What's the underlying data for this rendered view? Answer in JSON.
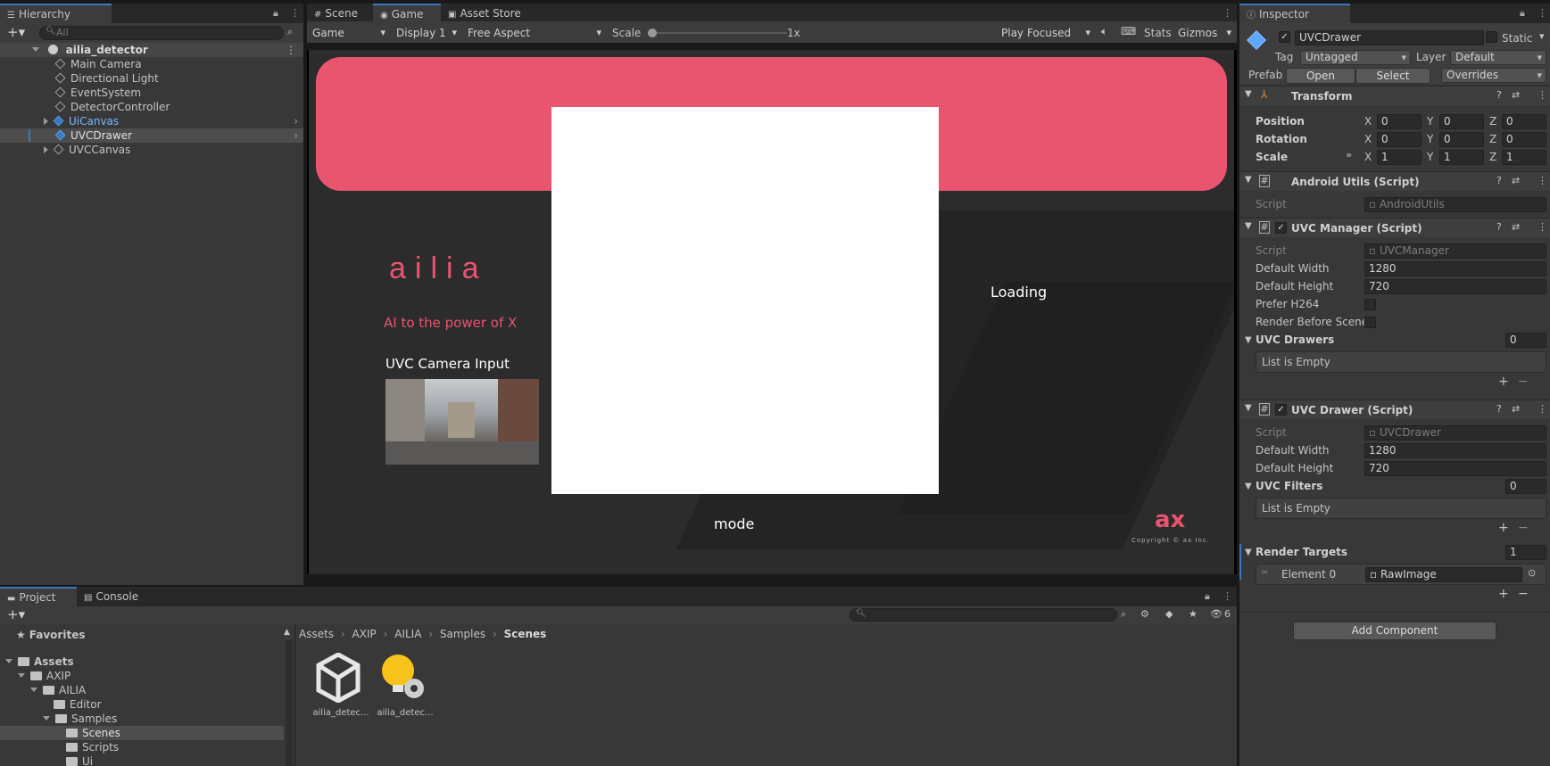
{
  "hierarchy": {
    "tab": "Hierarchy",
    "search_placeholder": "All",
    "scene": "ailia_detector",
    "items": [
      "Main Camera",
      "Directional Light",
      "EventSystem",
      "DetectorController",
      "UiCanvas",
      "UVCDrawer",
      "UVCCanvas"
    ]
  },
  "center_tabs": [
    "Scene",
    "Game",
    "Asset Store"
  ],
  "game_toolbar": {
    "mode": "Game",
    "display": "Display 1",
    "aspect": "Free Aspect",
    "scale_label": "Scale",
    "scale_value": "1x",
    "play": "Play Focused",
    "stats": "Stats",
    "gizmos": "Gizmos"
  },
  "game_view": {
    "logo": "ailia",
    "tagline": "AI to the power of X",
    "camera_label": "UVC Camera Input",
    "loading": "Loading",
    "mode": "mode",
    "ax_logo": "ax",
    "copyright": "Copyright © ax Inc.",
    "colors": {
      "banner": "#e9546e",
      "bg": "#2e2e2e",
      "accent": "#e9546e"
    }
  },
  "inspector": {
    "tab": "Inspector",
    "object_name": "UVCDrawer",
    "static_label": "Static",
    "tag_label": "Tag",
    "tag_value": "Untagged",
    "layer_label": "Layer",
    "layer_value": "Default",
    "prefab_label": "Prefab",
    "open": "Open",
    "select": "Select",
    "overrides": "Overrides",
    "transform": {
      "title": "Transform",
      "rows": [
        {
          "label": "Position",
          "x": "0",
          "y": "0",
          "z": "0"
        },
        {
          "label": "Rotation",
          "x": "0",
          "y": "0",
          "z": "0"
        },
        {
          "label": "Scale",
          "x": "1",
          "y": "1",
          "z": "1"
        }
      ],
      "axes": [
        "X",
        "Y",
        "Z"
      ]
    },
    "android_utils": {
      "title": "Android Utils (Script)",
      "script_label": "Script",
      "script_value": "AndroidUtils"
    },
    "uvc_manager": {
      "title": "UVC Manager (Script)",
      "script_label": "Script",
      "script_value": "UVCManager",
      "width_label": "Default Width",
      "width_value": "1280",
      "height_label": "Default Height",
      "height_value": "720",
      "h264_label": "Prefer H264",
      "render_label": "Render Before Scene",
      "drawers_label": "UVC Drawers",
      "drawers_count": "0",
      "empty": "List is Empty"
    },
    "uvc_drawer": {
      "title": "UVC Drawer (Script)",
      "script_label": "Script",
      "script_value": "UVCDrawer",
      "width_label": "Default Width",
      "width_value": "1280",
      "height_label": "Default Height",
      "height_value": "720",
      "filters_label": "UVC Filters",
      "filters_count": "0",
      "empty": "List is Empty",
      "targets_label": "Render Targets",
      "targets_count": "1",
      "element_label": "Element 0",
      "element_value": "RawImage"
    },
    "add_component": "Add Component"
  },
  "project": {
    "tabs": [
      "Project",
      "Console"
    ],
    "favorites": "Favorites",
    "tree": [
      "Assets",
      "AXIP",
      "AILIA",
      "Editor",
      "Samples",
      "Scenes",
      "Scripts",
      "Ui"
    ],
    "breadcrumb": [
      "Assets",
      "AXIP",
      "AILIA",
      "Samples",
      "Scenes"
    ],
    "badge_count": "6",
    "assets": [
      "ailia_detec...",
      "ailia_detec..."
    ]
  }
}
